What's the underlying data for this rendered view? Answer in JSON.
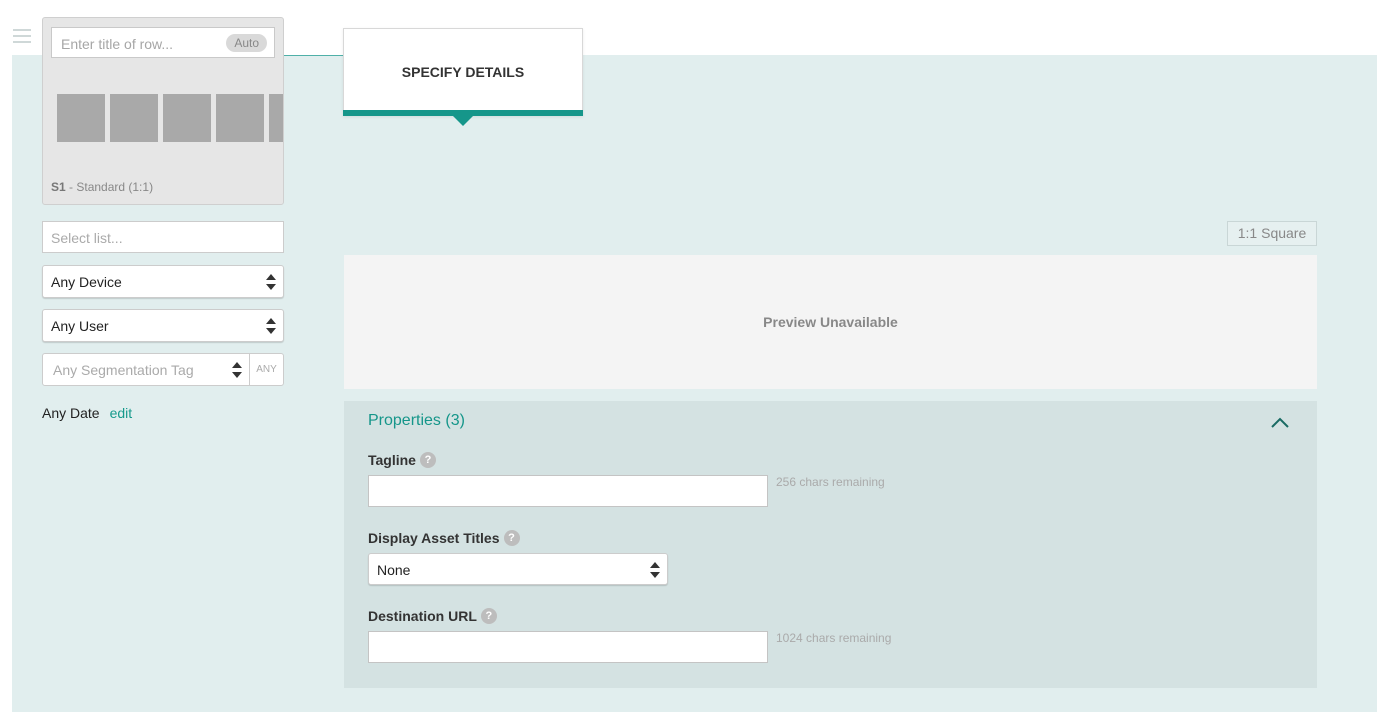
{
  "row": {
    "title_placeholder": "Enter title of row...",
    "auto_label": "Auto",
    "style_code": "S1",
    "style_desc": " - Standard (1:1)"
  },
  "filters": {
    "list_placeholder": "Select list...",
    "device_value": "Any Device",
    "user_value": "Any User",
    "segmentation_placeholder": "Any Segmentation Tag",
    "any_label": "ANY",
    "date_label": "Any Date",
    "edit_label": "edit"
  },
  "tab": {
    "label": "SPECIFY DETAILS"
  },
  "preview": {
    "ratio_label": "1:1 Square",
    "message": "Preview Unavailable"
  },
  "properties": {
    "title": "Properties (3)",
    "fields": [
      {
        "label": "Tagline",
        "help": "?",
        "remaining": "256 chars remaining"
      },
      {
        "label": "Display Asset Titles",
        "help": "?",
        "value": "None"
      },
      {
        "label": "Destination URL",
        "help": "?",
        "remaining": "1024 chars remaining"
      }
    ]
  },
  "colors": {
    "accent": "#15968a",
    "panel_bg": "#e1eeee",
    "properties_bg": "#d4e2e2"
  }
}
